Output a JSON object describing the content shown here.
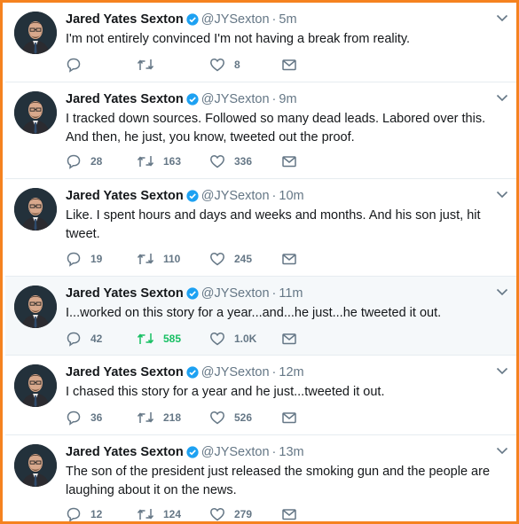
{
  "author": {
    "name": "Jared Yates Sexton",
    "handle": "@JYSexton"
  },
  "colors": {
    "frame": "#f5821f",
    "verified": "#1da1f2",
    "muted": "#657786",
    "retweet_active": "#17bf63"
  },
  "tweets": [
    {
      "time": "5m",
      "text": "I'm not entirely convinced I'm not having a break from reality.",
      "replies": "",
      "retweets": "",
      "likes": "8"
    },
    {
      "time": "9m",
      "text": "I tracked down sources. Followed so many dead leads. Labored over this. And then, he just, you know, tweeted out the proof.",
      "replies": "28",
      "retweets": "163",
      "likes": "336"
    },
    {
      "time": "10m",
      "text": "Like. I spent hours and days and weeks and months. And his son just, hit tweet.",
      "replies": "19",
      "retweets": "110",
      "likes": "245"
    },
    {
      "time": "11m",
      "text": "I...worked on this story for a year...and...he just...he tweeted it out.",
      "replies": "42",
      "retweets": "585",
      "likes": "1.0K"
    },
    {
      "time": "12m",
      "text": "I chased this story for a year and he just...tweeted it out.",
      "replies": "36",
      "retweets": "218",
      "likes": "526"
    },
    {
      "time": "13m",
      "text": "The son of the president just released the smoking gun and the people are laughing about it on the news.",
      "replies": "12",
      "retweets": "124",
      "likes": "279"
    }
  ]
}
